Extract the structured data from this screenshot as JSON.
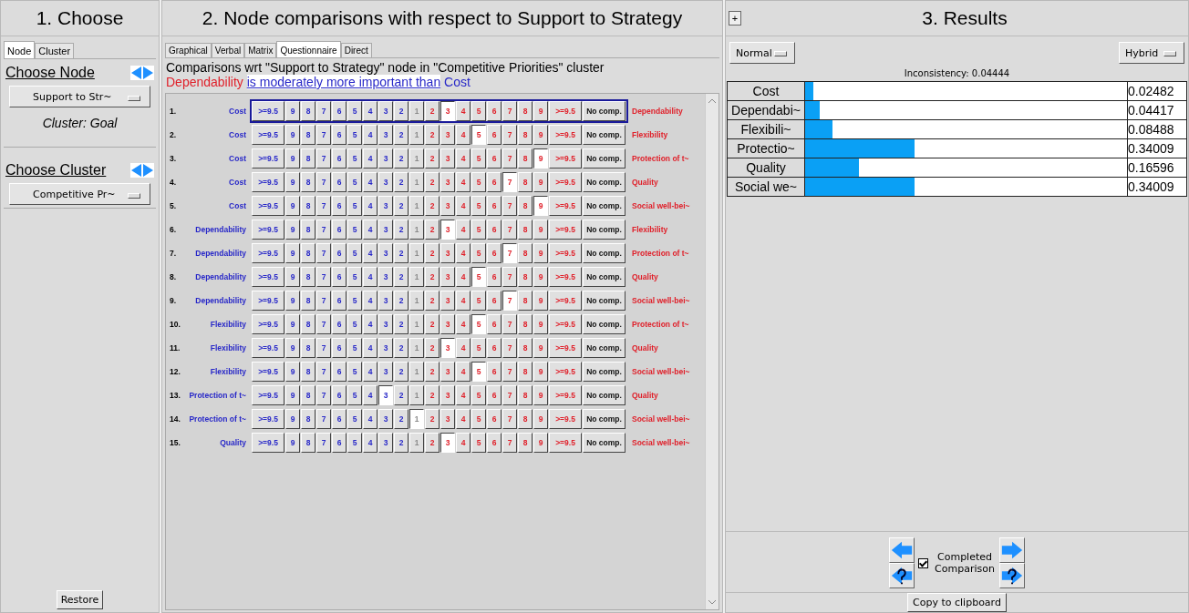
{
  "choose": {
    "title": "1. Choose",
    "tabs": [
      {
        "label": "Node",
        "selected": true
      },
      {
        "label": "Cluster",
        "selected": false
      }
    ],
    "node_heading": "Choose Node",
    "node_dropdown": "Support to Str~",
    "cluster_note": "Cluster: Goal",
    "cluster_heading": "Choose Cluster",
    "cluster_dropdown": "Competitive Pr~",
    "restore_button": "Restore"
  },
  "comparisons": {
    "title": "2. Node comparisons with respect to Support to Strategy",
    "tabs": [
      {
        "label": "Graphical",
        "selected": false
      },
      {
        "label": "Verbal",
        "selected": false
      },
      {
        "label": "Matrix",
        "selected": false
      },
      {
        "label": "Questionnaire",
        "selected": true
      },
      {
        "label": "Direct",
        "selected": false
      }
    ],
    "heading": "Comparisons wrt \"Support to Strategy\" node in \"Competitive Priorities\" cluster",
    "verbal": {
      "left": "Dependability",
      "phrase": "is moderately more important than",
      "right": "Cost"
    },
    "rows": [
      {
        "number": "1.",
        "left": "Cost",
        "right": "Dependability",
        "focused": true,
        "cells": [
          {
            "label": ">=9.5",
            "selected": false
          },
          {
            "label": "9",
            "selected": false
          },
          {
            "label": "8",
            "selected": false
          },
          {
            "label": "7",
            "selected": false
          },
          {
            "label": "6",
            "selected": false
          },
          {
            "label": "5",
            "selected": false
          },
          {
            "label": "4",
            "selected": false
          },
          {
            "label": "3",
            "selected": false
          },
          {
            "label": "2",
            "selected": false
          },
          {
            "label": "1",
            "selected": false
          },
          {
            "label": "2",
            "selected": false
          },
          {
            "label": "3",
            "selected": true
          },
          {
            "label": "4",
            "selected": false
          },
          {
            "label": "5",
            "selected": false
          },
          {
            "label": "6",
            "selected": false
          },
          {
            "label": "7",
            "selected": false
          },
          {
            "label": "8",
            "selected": false
          },
          {
            "label": "9",
            "selected": false
          },
          {
            "label": ">=9.5",
            "selected": false
          },
          {
            "label": "No comp.",
            "selected": false
          }
        ]
      },
      {
        "number": "2.",
        "left": "Cost",
        "right": "Flexibility",
        "focused": false,
        "cells": [
          {
            "label": ">=9.5",
            "selected": false
          },
          {
            "label": "9",
            "selected": false
          },
          {
            "label": "8",
            "selected": false
          },
          {
            "label": "7",
            "selected": false
          },
          {
            "label": "6",
            "selected": false
          },
          {
            "label": "5",
            "selected": false
          },
          {
            "label": "4",
            "selected": false
          },
          {
            "label": "3",
            "selected": false
          },
          {
            "label": "2",
            "selected": false
          },
          {
            "label": "1",
            "selected": false
          },
          {
            "label": "2",
            "selected": false
          },
          {
            "label": "3",
            "selected": false
          },
          {
            "label": "4",
            "selected": false
          },
          {
            "label": "5",
            "selected": true
          },
          {
            "label": "6",
            "selected": false
          },
          {
            "label": "7",
            "selected": false
          },
          {
            "label": "8",
            "selected": false
          },
          {
            "label": "9",
            "selected": false
          },
          {
            "label": ">=9.5",
            "selected": false
          },
          {
            "label": "No comp.",
            "selected": false
          }
        ]
      },
      {
        "number": "3.",
        "left": "Cost",
        "right": "Protection of t~",
        "focused": false,
        "cells": [
          {
            "label": ">=9.5",
            "selected": false
          },
          {
            "label": "9",
            "selected": false
          },
          {
            "label": "8",
            "selected": false
          },
          {
            "label": "7",
            "selected": false
          },
          {
            "label": "6",
            "selected": false
          },
          {
            "label": "5",
            "selected": false
          },
          {
            "label": "4",
            "selected": false
          },
          {
            "label": "3",
            "selected": false
          },
          {
            "label": "2",
            "selected": false
          },
          {
            "label": "1",
            "selected": false
          },
          {
            "label": "2",
            "selected": false
          },
          {
            "label": "3",
            "selected": false
          },
          {
            "label": "4",
            "selected": false
          },
          {
            "label": "5",
            "selected": false
          },
          {
            "label": "6",
            "selected": false
          },
          {
            "label": "7",
            "selected": false
          },
          {
            "label": "8",
            "selected": false
          },
          {
            "label": "9",
            "selected": true
          },
          {
            "label": ">=9.5",
            "selected": false
          },
          {
            "label": "No comp.",
            "selected": false
          }
        ]
      },
      {
        "number": "4.",
        "left": "Cost",
        "right": "Quality",
        "focused": false,
        "cells": [
          {
            "label": ">=9.5",
            "selected": false
          },
          {
            "label": "9",
            "selected": false
          },
          {
            "label": "8",
            "selected": false
          },
          {
            "label": "7",
            "selected": false
          },
          {
            "label": "6",
            "selected": false
          },
          {
            "label": "5",
            "selected": false
          },
          {
            "label": "4",
            "selected": false
          },
          {
            "label": "3",
            "selected": false
          },
          {
            "label": "2",
            "selected": false
          },
          {
            "label": "1",
            "selected": false
          },
          {
            "label": "2",
            "selected": false
          },
          {
            "label": "3",
            "selected": false
          },
          {
            "label": "4",
            "selected": false
          },
          {
            "label": "5",
            "selected": false
          },
          {
            "label": "6",
            "selected": false
          },
          {
            "label": "7",
            "selected": true
          },
          {
            "label": "8",
            "selected": false
          },
          {
            "label": "9",
            "selected": false
          },
          {
            "label": ">=9.5",
            "selected": false
          },
          {
            "label": "No comp.",
            "selected": false
          }
        ]
      },
      {
        "number": "5.",
        "left": "Cost",
        "right": "Social well-bei~",
        "focused": false,
        "cells": [
          {
            "label": ">=9.5",
            "selected": false
          },
          {
            "label": "9",
            "selected": false
          },
          {
            "label": "8",
            "selected": false
          },
          {
            "label": "7",
            "selected": false
          },
          {
            "label": "6",
            "selected": false
          },
          {
            "label": "5",
            "selected": false
          },
          {
            "label": "4",
            "selected": false
          },
          {
            "label": "3",
            "selected": false
          },
          {
            "label": "2",
            "selected": false
          },
          {
            "label": "1",
            "selected": false
          },
          {
            "label": "2",
            "selected": false
          },
          {
            "label": "3",
            "selected": false
          },
          {
            "label": "4",
            "selected": false
          },
          {
            "label": "5",
            "selected": false
          },
          {
            "label": "6",
            "selected": false
          },
          {
            "label": "7",
            "selected": false
          },
          {
            "label": "8",
            "selected": false
          },
          {
            "label": "9",
            "selected": true
          },
          {
            "label": ">=9.5",
            "selected": false
          },
          {
            "label": "No comp.",
            "selected": false
          }
        ]
      },
      {
        "number": "6.",
        "left": "Dependability",
        "right": "Flexibility",
        "focused": false,
        "cells": [
          {
            "label": ">=9.5",
            "selected": false
          },
          {
            "label": "9",
            "selected": false
          },
          {
            "label": "8",
            "selected": false
          },
          {
            "label": "7",
            "selected": false
          },
          {
            "label": "6",
            "selected": false
          },
          {
            "label": "5",
            "selected": false
          },
          {
            "label": "4",
            "selected": false
          },
          {
            "label": "3",
            "selected": false
          },
          {
            "label": "2",
            "selected": false
          },
          {
            "label": "1",
            "selected": false
          },
          {
            "label": "2",
            "selected": false
          },
          {
            "label": "3",
            "selected": true
          },
          {
            "label": "4",
            "selected": false
          },
          {
            "label": "5",
            "selected": false
          },
          {
            "label": "6",
            "selected": false
          },
          {
            "label": "7",
            "selected": false
          },
          {
            "label": "8",
            "selected": false
          },
          {
            "label": "9",
            "selected": false
          },
          {
            "label": ">=9.5",
            "selected": false
          },
          {
            "label": "No comp.",
            "selected": false
          }
        ]
      },
      {
        "number": "7.",
        "left": "Dependability",
        "right": "Protection of t~",
        "focused": false,
        "cells": [
          {
            "label": ">=9.5",
            "selected": false
          },
          {
            "label": "9",
            "selected": false
          },
          {
            "label": "8",
            "selected": false
          },
          {
            "label": "7",
            "selected": false
          },
          {
            "label": "6",
            "selected": false
          },
          {
            "label": "5",
            "selected": false
          },
          {
            "label": "4",
            "selected": false
          },
          {
            "label": "3",
            "selected": false
          },
          {
            "label": "2",
            "selected": false
          },
          {
            "label": "1",
            "selected": false
          },
          {
            "label": "2",
            "selected": false
          },
          {
            "label": "3",
            "selected": false
          },
          {
            "label": "4",
            "selected": false
          },
          {
            "label": "5",
            "selected": false
          },
          {
            "label": "6",
            "selected": false
          },
          {
            "label": "7",
            "selected": true
          },
          {
            "label": "8",
            "selected": false
          },
          {
            "label": "9",
            "selected": false
          },
          {
            "label": ">=9.5",
            "selected": false
          },
          {
            "label": "No comp.",
            "selected": false
          }
        ]
      },
      {
        "number": "8.",
        "left": "Dependability",
        "right": "Quality",
        "focused": false,
        "cells": [
          {
            "label": ">=9.5",
            "selected": false
          },
          {
            "label": "9",
            "selected": false
          },
          {
            "label": "8",
            "selected": false
          },
          {
            "label": "7",
            "selected": false
          },
          {
            "label": "6",
            "selected": false
          },
          {
            "label": "5",
            "selected": false
          },
          {
            "label": "4",
            "selected": false
          },
          {
            "label": "3",
            "selected": false
          },
          {
            "label": "2",
            "selected": false
          },
          {
            "label": "1",
            "selected": false
          },
          {
            "label": "2",
            "selected": false
          },
          {
            "label": "3",
            "selected": false
          },
          {
            "label": "4",
            "selected": false
          },
          {
            "label": "5",
            "selected": true
          },
          {
            "label": "6",
            "selected": false
          },
          {
            "label": "7",
            "selected": false
          },
          {
            "label": "8",
            "selected": false
          },
          {
            "label": "9",
            "selected": false
          },
          {
            "label": ">=9.5",
            "selected": false
          },
          {
            "label": "No comp.",
            "selected": false
          }
        ]
      },
      {
        "number": "9.",
        "left": "Dependability",
        "right": "Social well-bei~",
        "focused": false,
        "cells": [
          {
            "label": ">=9.5",
            "selected": false
          },
          {
            "label": "9",
            "selected": false
          },
          {
            "label": "8",
            "selected": false
          },
          {
            "label": "7",
            "selected": false
          },
          {
            "label": "6",
            "selected": false
          },
          {
            "label": "5",
            "selected": false
          },
          {
            "label": "4",
            "selected": false
          },
          {
            "label": "3",
            "selected": false
          },
          {
            "label": "2",
            "selected": false
          },
          {
            "label": "1",
            "selected": false
          },
          {
            "label": "2",
            "selected": false
          },
          {
            "label": "3",
            "selected": false
          },
          {
            "label": "4",
            "selected": false
          },
          {
            "label": "5",
            "selected": false
          },
          {
            "label": "6",
            "selected": false
          },
          {
            "label": "7",
            "selected": true
          },
          {
            "label": "8",
            "selected": false
          },
          {
            "label": "9",
            "selected": false
          },
          {
            "label": ">=9.5",
            "selected": false
          },
          {
            "label": "No comp.",
            "selected": false
          }
        ]
      },
      {
        "number": "10.",
        "left": "Flexibility",
        "right": "Protection of t~",
        "focused": false,
        "cells": [
          {
            "label": ">=9.5",
            "selected": false
          },
          {
            "label": "9",
            "selected": false
          },
          {
            "label": "8",
            "selected": false
          },
          {
            "label": "7",
            "selected": false
          },
          {
            "label": "6",
            "selected": false
          },
          {
            "label": "5",
            "selected": false
          },
          {
            "label": "4",
            "selected": false
          },
          {
            "label": "3",
            "selected": false
          },
          {
            "label": "2",
            "selected": false
          },
          {
            "label": "1",
            "selected": false
          },
          {
            "label": "2",
            "selected": false
          },
          {
            "label": "3",
            "selected": false
          },
          {
            "label": "4",
            "selected": false
          },
          {
            "label": "5",
            "selected": true
          },
          {
            "label": "6",
            "selected": false
          },
          {
            "label": "7",
            "selected": false
          },
          {
            "label": "8",
            "selected": false
          },
          {
            "label": "9",
            "selected": false
          },
          {
            "label": ">=9.5",
            "selected": false
          },
          {
            "label": "No comp.",
            "selected": false
          }
        ]
      },
      {
        "number": "11.",
        "left": "Flexibility",
        "right": "Quality",
        "focused": false,
        "cells": [
          {
            "label": ">=9.5",
            "selected": false
          },
          {
            "label": "9",
            "selected": false
          },
          {
            "label": "8",
            "selected": false
          },
          {
            "label": "7",
            "selected": false
          },
          {
            "label": "6",
            "selected": false
          },
          {
            "label": "5",
            "selected": false
          },
          {
            "label": "4",
            "selected": false
          },
          {
            "label": "3",
            "selected": false
          },
          {
            "label": "2",
            "selected": false
          },
          {
            "label": "1",
            "selected": false
          },
          {
            "label": "2",
            "selected": false
          },
          {
            "label": "3",
            "selected": true
          },
          {
            "label": "4",
            "selected": false
          },
          {
            "label": "5",
            "selected": false
          },
          {
            "label": "6",
            "selected": false
          },
          {
            "label": "7",
            "selected": false
          },
          {
            "label": "8",
            "selected": false
          },
          {
            "label": "9",
            "selected": false
          },
          {
            "label": ">=9.5",
            "selected": false
          },
          {
            "label": "No comp.",
            "selected": false
          }
        ]
      },
      {
        "number": "12.",
        "left": "Flexibility",
        "right": "Social well-bei~",
        "focused": false,
        "cells": [
          {
            "label": ">=9.5",
            "selected": false
          },
          {
            "label": "9",
            "selected": false
          },
          {
            "label": "8",
            "selected": false
          },
          {
            "label": "7",
            "selected": false
          },
          {
            "label": "6",
            "selected": false
          },
          {
            "label": "5",
            "selected": false
          },
          {
            "label": "4",
            "selected": false
          },
          {
            "label": "3",
            "selected": false
          },
          {
            "label": "2",
            "selected": false
          },
          {
            "label": "1",
            "selected": false
          },
          {
            "label": "2",
            "selected": false
          },
          {
            "label": "3",
            "selected": false
          },
          {
            "label": "4",
            "selected": false
          },
          {
            "label": "5",
            "selected": true
          },
          {
            "label": "6",
            "selected": false
          },
          {
            "label": "7",
            "selected": false
          },
          {
            "label": "8",
            "selected": false
          },
          {
            "label": "9",
            "selected": false
          },
          {
            "label": ">=9.5",
            "selected": false
          },
          {
            "label": "No comp.",
            "selected": false
          }
        ]
      },
      {
        "number": "13.",
        "left": "Protection of t~",
        "right": "Quality",
        "focused": false,
        "cells": [
          {
            "label": ">=9.5",
            "selected": false
          },
          {
            "label": "9",
            "selected": false
          },
          {
            "label": "8",
            "selected": false
          },
          {
            "label": "7",
            "selected": false
          },
          {
            "label": "6",
            "selected": false
          },
          {
            "label": "5",
            "selected": false
          },
          {
            "label": "4",
            "selected": false
          },
          {
            "label": "3",
            "selected": true
          },
          {
            "label": "2",
            "selected": false
          },
          {
            "label": "1",
            "selected": false
          },
          {
            "label": "2",
            "selected": false
          },
          {
            "label": "3",
            "selected": false
          },
          {
            "label": "4",
            "selected": false
          },
          {
            "label": "5",
            "selected": false
          },
          {
            "label": "6",
            "selected": false
          },
          {
            "label": "7",
            "selected": false
          },
          {
            "label": "8",
            "selected": false
          },
          {
            "label": "9",
            "selected": false
          },
          {
            "label": ">=9.5",
            "selected": false
          },
          {
            "label": "No comp.",
            "selected": false
          }
        ]
      },
      {
        "number": "14.",
        "left": "Protection of t~",
        "right": "Social well-bei~",
        "focused": false,
        "cells": [
          {
            "label": ">=9.5",
            "selected": false
          },
          {
            "label": "9",
            "selected": false
          },
          {
            "label": "8",
            "selected": false
          },
          {
            "label": "7",
            "selected": false
          },
          {
            "label": "6",
            "selected": false
          },
          {
            "label": "5",
            "selected": false
          },
          {
            "label": "4",
            "selected": false
          },
          {
            "label": "3",
            "selected": false
          },
          {
            "label": "2",
            "selected": false
          },
          {
            "label": "1",
            "selected": true
          },
          {
            "label": "2",
            "selected": false
          },
          {
            "label": "3",
            "selected": false
          },
          {
            "label": "4",
            "selected": false
          },
          {
            "label": "5",
            "selected": false
          },
          {
            "label": "6",
            "selected": false
          },
          {
            "label": "7",
            "selected": false
          },
          {
            "label": "8",
            "selected": false
          },
          {
            "label": "9",
            "selected": false
          },
          {
            "label": ">=9.5",
            "selected": false
          },
          {
            "label": "No comp.",
            "selected": false
          }
        ]
      },
      {
        "number": "15.",
        "left": "Quality",
        "right": "Social well-bei~",
        "focused": false,
        "cells": [
          {
            "label": ">=9.5",
            "selected": false
          },
          {
            "label": "9",
            "selected": false
          },
          {
            "label": "8",
            "selected": false
          },
          {
            "label": "7",
            "selected": false
          },
          {
            "label": "6",
            "selected": false
          },
          {
            "label": "5",
            "selected": false
          },
          {
            "label": "4",
            "selected": false
          },
          {
            "label": "3",
            "selected": false
          },
          {
            "label": "2",
            "selected": false
          },
          {
            "label": "1",
            "selected": false
          },
          {
            "label": "2",
            "selected": false
          },
          {
            "label": "3",
            "selected": true
          },
          {
            "label": "4",
            "selected": false
          },
          {
            "label": "5",
            "selected": false
          },
          {
            "label": "6",
            "selected": false
          },
          {
            "label": "7",
            "selected": false
          },
          {
            "label": "8",
            "selected": false
          },
          {
            "label": "9",
            "selected": false
          },
          {
            "label": ">=9.5",
            "selected": false
          },
          {
            "label": "No comp.",
            "selected": false
          }
        ]
      }
    ]
  },
  "results": {
    "expand_button": "+",
    "title": "3. Results",
    "mode_dropdown": "Normal",
    "method_dropdown": "Hybrid",
    "inconsistency": "Inconsistency: 0.04444",
    "priorities": [
      {
        "name": "Cost",
        "level": 0.02482,
        "value": "0.02482"
      },
      {
        "name": "Dependabi~",
        "level": 0.04417,
        "value": "0.04417"
      },
      {
        "name": "Flexibili~",
        "level": 0.08488,
        "value": "0.08488"
      },
      {
        "name": "Protectio~",
        "level": 0.34009,
        "value": "0.34009"
      },
      {
        "name": "Quality",
        "level": 0.16596,
        "value": "0.16596"
      },
      {
        "name": "Social we~",
        "level": 0.34009,
        "value": "0.34009"
      }
    ],
    "completed": {
      "label": "Completed Comparison",
      "checked": true
    },
    "copy_button": "Copy to clipboard"
  }
}
